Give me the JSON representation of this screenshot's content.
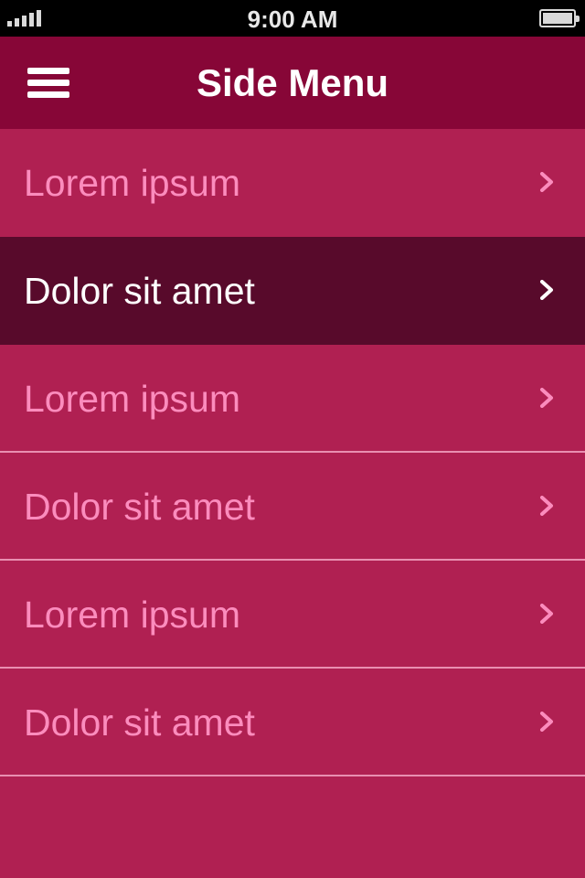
{
  "status_bar": {
    "time": "9:00 AM",
    "signal_icon": "signal-bars-icon",
    "battery_icon": "battery-icon"
  },
  "header": {
    "title": "Side Menu",
    "menu_icon": "hamburger-menu-icon",
    "background": "#870637"
  },
  "menu": {
    "items": [
      {
        "label": "Lorem ipsum",
        "selected": false
      },
      {
        "label": "Dolor sit amet",
        "selected": true
      },
      {
        "label": "Lorem ipsum",
        "selected": false
      },
      {
        "label": "Dolor sit amet",
        "selected": false
      },
      {
        "label": "Lorem ipsum",
        "selected": false
      },
      {
        "label": "Dolor sit amet",
        "selected": false
      }
    ],
    "chevron_icon": "chevron-right-icon"
  },
  "colors": {
    "item_background": "#b02052",
    "selected_background": "#580a2b",
    "item_text": "#fb8cbd",
    "selected_text": "#ffffff",
    "divider": "#e98fb1"
  }
}
